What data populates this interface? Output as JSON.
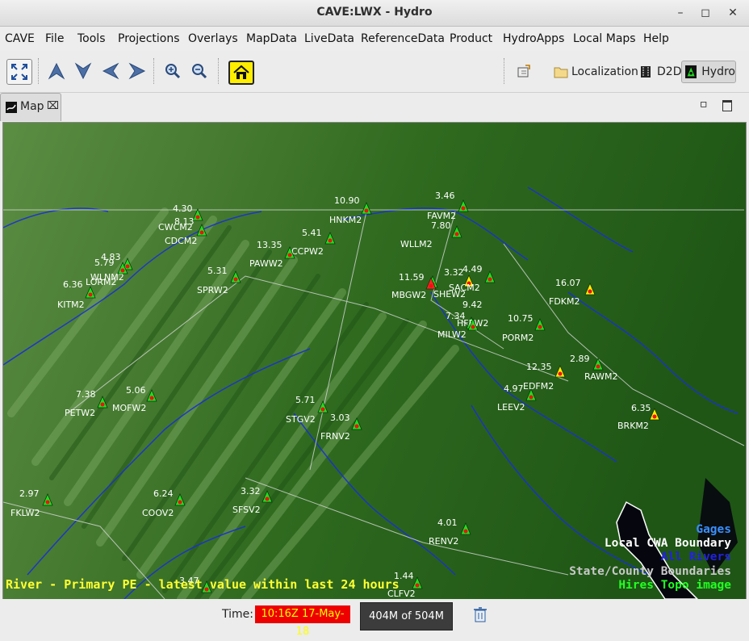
{
  "window": {
    "title": "CAVE:LWX - Hydro"
  },
  "menu": [
    "CAVE",
    "File",
    "Tools",
    "Projections",
    "Overlays",
    "MapData",
    "LiveData",
    "ReferenceData",
    "Product",
    "HydroApps",
    "Local Maps",
    "Help"
  ],
  "toolbar": {
    "tools": [
      "zoom-extent-icon",
      "pan-up-icon",
      "pan-down-icon",
      "pan-left-icon",
      "pan-right-icon",
      "zoom-in-icon",
      "zoom-out-icon",
      "hydro-home-icon"
    ],
    "perspectives": [
      "Localization",
      "D2D",
      "Hydro"
    ],
    "active_perspective": "Hydro"
  },
  "tab": {
    "label": "Map"
  },
  "map": {
    "caption": "River - Primary PE - latest value within last 24 hours",
    "legend": [
      {
        "label": "Gages",
        "color": "#3a8fff"
      },
      {
        "label": "Local CWA Boundary",
        "color": "#ffffff"
      },
      {
        "label": "All Rivers",
        "color": "#2222dd"
      },
      {
        "label": "State/County Boundaries",
        "color": "#c8c8c8"
      },
      {
        "label": "Hires Topo image",
        "color": "#22ff22"
      }
    ],
    "gages": [
      {
        "id": "FAVM2",
        "value": "3.46",
        "color": "green"
      },
      {
        "id": "HNKM2",
        "value": "10.90",
        "color": "green"
      },
      {
        "id": "CWCM2",
        "value": "4.30",
        "color": "green"
      },
      {
        "id": "CDCM2",
        "value": "8.13",
        "color": "green"
      },
      {
        "id": "WLLM2",
        "value": "7.80",
        "color": "green"
      },
      {
        "id": "CCPW2",
        "value": "5.41",
        "color": "green"
      },
      {
        "id": "PAWW2",
        "value": "13.35",
        "color": "green"
      },
      {
        "id": "WLNM2",
        "value": "4.83",
        "color": "green"
      },
      {
        "id": "LORM2",
        "value": "5.79",
        "color": "green"
      },
      {
        "id": "SPRW2",
        "value": "5.31",
        "color": "green"
      },
      {
        "id": "KITM2",
        "value": "6.36",
        "color": "green"
      },
      {
        "id": "MBGW2",
        "value": "11.59",
        "color": "green"
      },
      {
        "id": "SHEW2",
        "value": "",
        "color": "red"
      },
      {
        "id": "SACM2",
        "value": "3.32",
        "color": "yellow"
      },
      {
        "id": "",
        "value": "4.49",
        "color": "green"
      },
      {
        "id": "FDKM2",
        "value": "16.07",
        "color": "yellow"
      },
      {
        "id": "HFEW2",
        "value": "9.42",
        "color": "green"
      },
      {
        "id": "MILW2",
        "value": "7.34",
        "color": "green"
      },
      {
        "id": "PORM2",
        "value": "10.75",
        "color": "green"
      },
      {
        "id": "EDFM2",
        "value": "12.35",
        "color": "yellow"
      },
      {
        "id": "RAWM2",
        "value": "2.89",
        "color": "green"
      },
      {
        "id": "LEEV2",
        "value": "4.97",
        "color": "green"
      },
      {
        "id": "BRKM2",
        "value": "6.35",
        "color": "yellow"
      },
      {
        "id": "PETW2",
        "value": "7.38",
        "color": "green"
      },
      {
        "id": "MOFW2",
        "value": "5.06",
        "color": "green"
      },
      {
        "id": "STGV2",
        "value": "5.71",
        "color": "green"
      },
      {
        "id": "FRNV2",
        "value": "3.03",
        "color": "green"
      },
      {
        "id": "FKLW2",
        "value": "2.97",
        "color": "green"
      },
      {
        "id": "COOV2",
        "value": "6.24",
        "color": "green"
      },
      {
        "id": "SFSV2",
        "value": "3.32",
        "color": "green"
      },
      {
        "id": "RENV2",
        "value": "4.01",
        "color": "green"
      },
      {
        "id": "CLFV2",
        "value": "1.44",
        "color": "green"
      },
      {
        "id": "",
        "value": "3.47",
        "color": "green"
      }
    ]
  },
  "status": {
    "time_label": "Time:",
    "time_value": "10:16Z 17-May-18",
    "memory": "404M of 504M"
  }
}
